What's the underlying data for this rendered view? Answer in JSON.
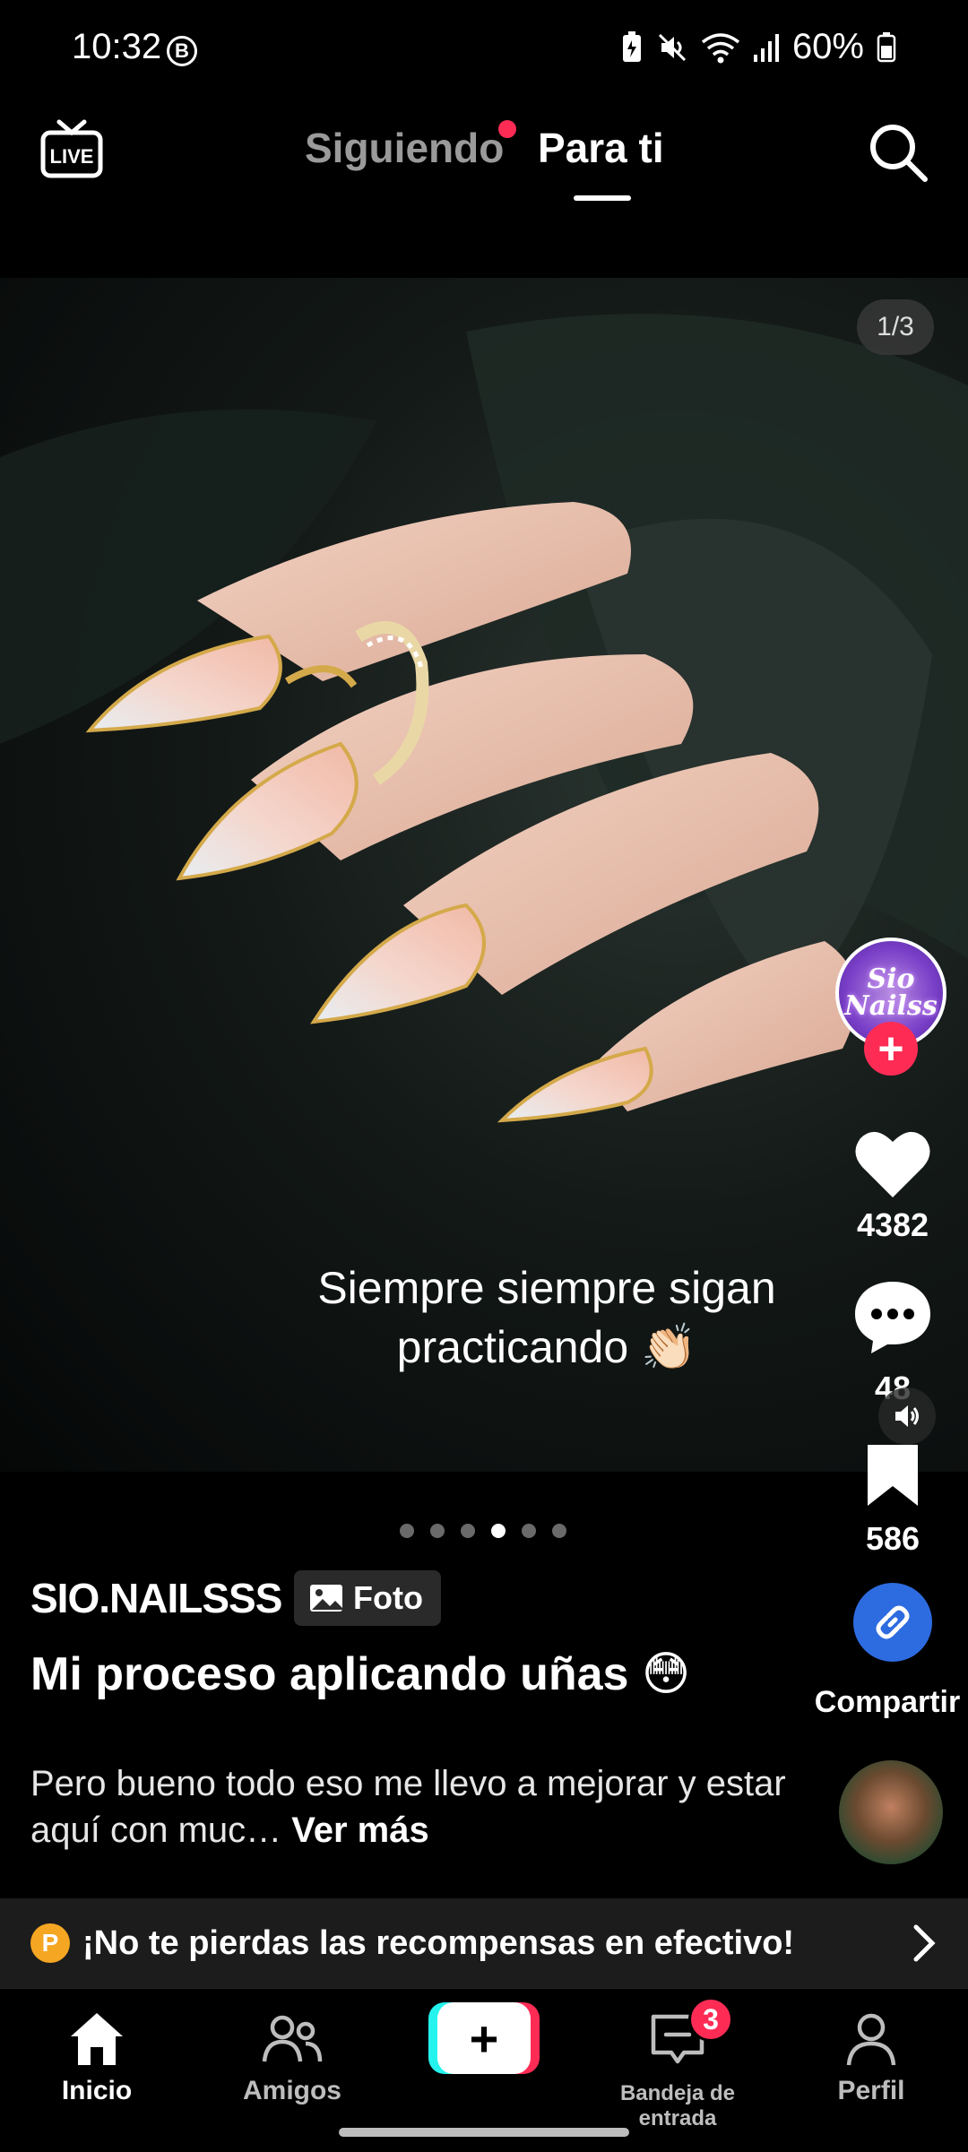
{
  "status_bar": {
    "time": "10:32",
    "badge": "B",
    "battery": "60%"
  },
  "top_nav": {
    "live_label": "LIVE",
    "tabs": [
      {
        "label": "Siguiendo",
        "active": false,
        "has_dot": true
      },
      {
        "label": "Para ti",
        "active": true
      }
    ]
  },
  "post": {
    "image_counter": "1/3",
    "overlay_caption": "Siempre siempre sigan practicando 👏🏻",
    "carousel": {
      "total": 6,
      "active_index": 3
    },
    "username": "SIO.NAILSSS",
    "type_chip": "Foto",
    "title": "Mi proceso aplicando uñas 😳",
    "description": "Pero bueno todo eso me llevo a mejorar y estar aquí con muc…",
    "see_more": "Ver más"
  },
  "creator": {
    "avatar_text": "Sio Nailss"
  },
  "actions": {
    "likes": "4382",
    "comments": "48",
    "saves": "586",
    "share_label": "Compartir"
  },
  "rewards_banner": {
    "coin_label": "P",
    "text": "¡No te pierdas las recompensas en efectivo!"
  },
  "bottom_nav": {
    "home": "Inicio",
    "friends": "Amigos",
    "create": "+",
    "inbox": "Bandeja de entrada",
    "inbox_badge": "3",
    "profile": "Perfil"
  },
  "colors": {
    "accent": "#fe2c55",
    "cyan": "#25f4ee",
    "share_blue": "#2d6be0",
    "coin": "#f5a623"
  }
}
